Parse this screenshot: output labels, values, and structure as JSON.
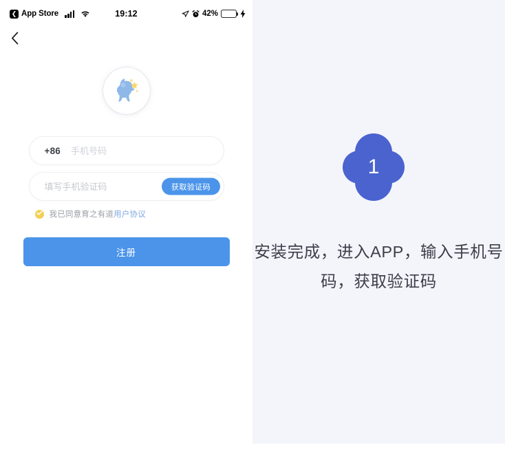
{
  "phone": {
    "status_bar": {
      "back_app_label": "App Store",
      "back_glyph": "chevron-left-boxed-icon",
      "signal_icon": "cellular-signal-icon",
      "wifi_icon": "wifi-icon",
      "time": "19:12",
      "location_icon": "location-arrow-icon",
      "alarm_icon": "alarm-clock-icon",
      "battery_percent": "42%",
      "battery_icon": "battery-icon",
      "charging_icon": "lightning-bolt-icon",
      "battery_level": 42
    },
    "nav": {
      "back_icon": "chevron-left-icon"
    },
    "logo": {
      "name": "app-logo-elephant-star",
      "colors": {
        "body": "#8fb8e8",
        "star": "#f6d96a",
        "ring": "#ffffff"
      }
    },
    "form": {
      "country_code": "+86",
      "phone_placeholder": "手机号码",
      "phone_value": "",
      "code_placeholder": "填写手机验证码",
      "code_value": "",
      "get_code_label": "获取验证码",
      "agreement_prefix": "我已同意育之有道",
      "agreement_link": "用户协议",
      "agreement_checked": true,
      "checkbox_icon": "check-circle-icon",
      "submit_label": "注册"
    },
    "colors": {
      "primary": "#4b94ea",
      "link": "#7fa9e4",
      "checkbox": "#f3cf55",
      "field_border": "#eceef2",
      "placeholder": "#cfd2d8"
    }
  },
  "guide": {
    "step_number": "1",
    "step_badge_icon": "clover-badge-icon",
    "instruction": "安装完成，进入APP，输入手机号码，获取验证码",
    "colors": {
      "background": "#f4f4fb",
      "badge": "#4a63cf",
      "text": "#3c4049"
    }
  }
}
